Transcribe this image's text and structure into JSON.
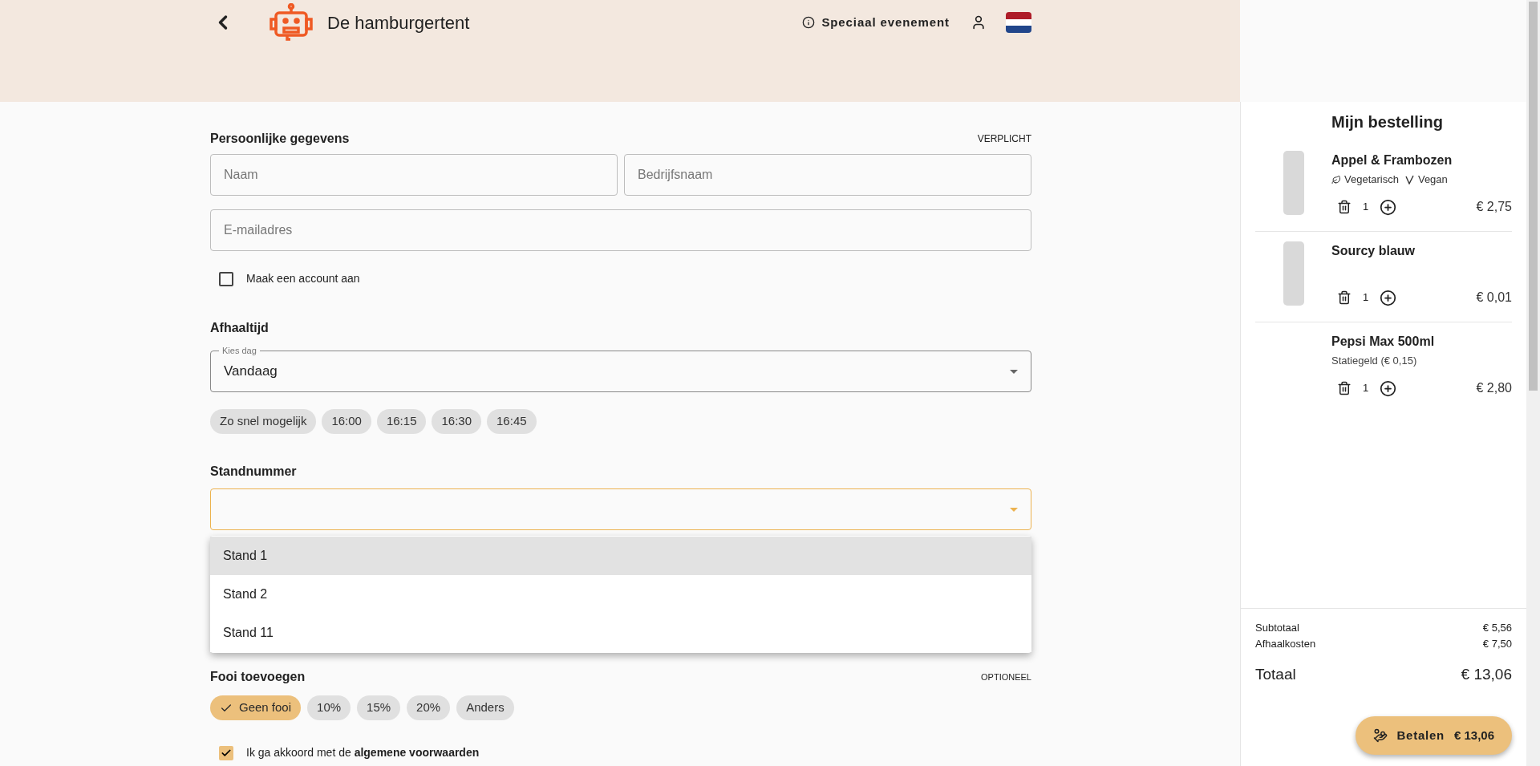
{
  "header": {
    "title": "De hamburgertent",
    "event_label": "Speciaal evenement"
  },
  "personal": {
    "title": "Persoonlijke gegevens",
    "badge": "VERPLICHT",
    "fields": [
      {
        "placeholder": "Naam"
      },
      {
        "placeholder": "Bedrijfsnaam"
      },
      {
        "placeholder": "E-mailadres"
      }
    ],
    "account": {
      "label": "Maak een account aan",
      "checked": false
    }
  },
  "pickup": {
    "title": "Afhaaltijd",
    "day_select": {
      "label": "Kies dag",
      "value": "Vandaag"
    },
    "times": [
      {
        "label": "Zo snel mogelijk",
        "selected": false
      },
      {
        "label": "16:00",
        "selected": false
      },
      {
        "label": "16:15",
        "selected": false
      },
      {
        "label": "16:30",
        "selected": false
      },
      {
        "label": "16:45",
        "selected": false
      }
    ]
  },
  "stand": {
    "title": "Standnummer",
    "expanded": true,
    "options": [
      {
        "label": "Stand 1",
        "highlighted": true
      },
      {
        "label": "Stand 2",
        "highlighted": false
      },
      {
        "label": "Stand 11",
        "highlighted": false
      }
    ]
  },
  "tip": {
    "title": "Fooi toevoegen",
    "badge": "OPTIONEEL",
    "options": [
      {
        "label": "Geen fooi",
        "selected": true
      },
      {
        "label": "10%",
        "selected": false
      },
      {
        "label": "15%",
        "selected": false
      },
      {
        "label": "20%",
        "selected": false
      },
      {
        "label": "Anders",
        "selected": false
      }
    ]
  },
  "terms": {
    "text": "Ik ga akkoord met de **algemene voorwaarden**",
    "checked": true
  },
  "order": {
    "title": "Mijn bestelling",
    "items": [
      {
        "name": "Appel & Frambozen",
        "photo": true,
        "tags": [
          {
            "kind": "vegetarian",
            "label": "Vegetarisch"
          },
          {
            "kind": "vegan",
            "label": "Vegan"
          }
        ],
        "quantity": "1",
        "price": "€ 2,75"
      },
      {
        "name": "Sourcy blauw",
        "photo": true,
        "quantity": "1",
        "price": "€ 0,01"
      },
      {
        "name": "Pepsi Max 500ml",
        "photo": false,
        "note": "Statiegeld (€ 0,15)",
        "quantity": "1",
        "price": "€ 2,80"
      }
    ],
    "subtotal": {
      "label": "Subtotaal",
      "value": "€ 5,56"
    },
    "fee": {
      "label": "Afhaalkosten",
      "value": "€ 7,50"
    },
    "total": {
      "label": "Totaal",
      "value": "€ 13,06"
    },
    "pay_button": {
      "label": "Betalen",
      "amount": "€ 13,06"
    }
  }
}
